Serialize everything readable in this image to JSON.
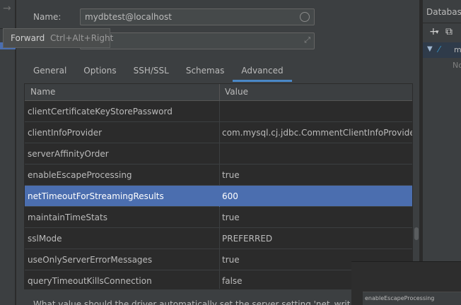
{
  "nav": {
    "forward_glyph": "→"
  },
  "tooltip": {
    "label": "Forward",
    "shortcut": "Ctrl+Alt+Right"
  },
  "dialog": {
    "name_label": "Name:",
    "name_value": "mydbtest@localhost",
    "comment_value": ""
  },
  "tabs": [
    {
      "label": "General",
      "active": false
    },
    {
      "label": "Options",
      "active": false
    },
    {
      "label": "SSH/SSL",
      "active": false
    },
    {
      "label": "Schemas",
      "active": false
    },
    {
      "label": "Advanced",
      "active": true
    }
  ],
  "table": {
    "columns": [
      "Name",
      "Value"
    ],
    "selected_row": "netTimeoutForStreamingResults",
    "rows": [
      {
        "name": "clientCertificateKeyStorePassword",
        "value": ""
      },
      {
        "name": "clientInfoProvider",
        "value": "com.mysql.cj.jdbc.CommentClientInfoProvider"
      },
      {
        "name": "serverAffinityOrder",
        "value": ""
      },
      {
        "name": "enableEscapeProcessing",
        "value": "true"
      },
      {
        "name": "netTimeoutForStreamingResults",
        "value": "600"
      },
      {
        "name": "maintainTimeStats",
        "value": "true"
      },
      {
        "name": "sslMode",
        "value": "PREFERRED"
      },
      {
        "name": "useOnlyServerErrorMessages",
        "value": "true"
      },
      {
        "name": "queryTimeoutKillsConnection",
        "value": "false"
      }
    ]
  },
  "description": "What value should the driver automatically set the server setting 'net_write_timeout' to w",
  "right_panel": {
    "title": "Database",
    "tree_label": "m",
    "no_text": "No"
  },
  "overlay": {
    "text": "enableEscapeProcessing"
  },
  "colors": {
    "selection": "#4b6eaf",
    "tab_underline": "#4a88c7",
    "panel_bg": "#3c3f41",
    "table_bg": "#2b2b2b"
  }
}
